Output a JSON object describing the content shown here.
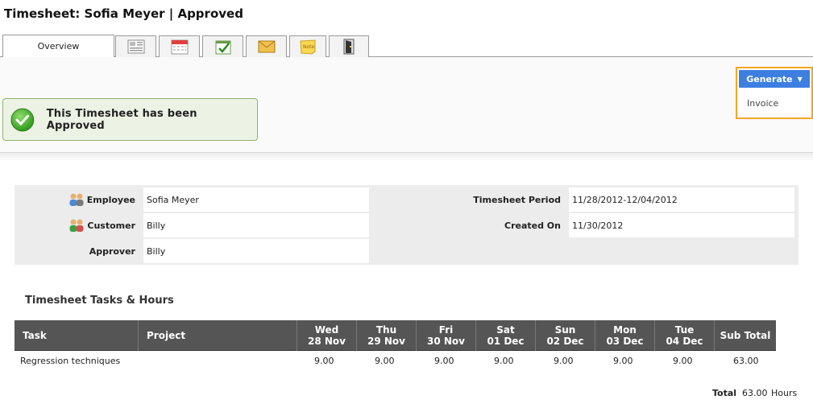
{
  "header": {
    "title": "Timesheet: Sofia Meyer | Approved"
  },
  "tabs": [
    {
      "label": "Overview",
      "icon": "overview"
    },
    {
      "label": "",
      "icon": "details-list-icon"
    },
    {
      "label": "",
      "icon": "calendar-icon"
    },
    {
      "label": "",
      "icon": "approval-check-icon"
    },
    {
      "label": "",
      "icon": "mail-icon"
    },
    {
      "label": "",
      "icon": "note-icon"
    },
    {
      "label": "",
      "icon": "door-exit-icon"
    }
  ],
  "status": {
    "message": "This Timesheet has been Approved",
    "color": "#4caf3a"
  },
  "generate": {
    "button_label": "Generate",
    "menu_item": "Invoice",
    "accent": "#3d7fe0",
    "highlight": "#f5a623"
  },
  "info": {
    "employee_label": "Employee",
    "employee_value": "Sofia Meyer",
    "customer_label": "Customer",
    "customer_value": "Billy",
    "approver_label": "Approver",
    "approver_value": "Billy",
    "period_label": "Timesheet Period",
    "period_value": "11/28/2012-12/04/2012",
    "created_label": "Created On",
    "created_value": "11/30/2012"
  },
  "tasks": {
    "title": "Timesheet Tasks & Hours",
    "columns": {
      "task": "Task",
      "project": "Project",
      "days": [
        {
          "day": "Wed",
          "date": "28 Nov"
        },
        {
          "day": "Thu",
          "date": "29 Nov"
        },
        {
          "day": "Fri",
          "date": "30 Nov"
        },
        {
          "day": "Sat",
          "date": "01 Dec"
        },
        {
          "day": "Sun",
          "date": "02 Dec"
        },
        {
          "day": "Mon",
          "date": "03 Dec"
        },
        {
          "day": "Tue",
          "date": "04 Dec"
        }
      ],
      "subtotal": "Sub Total"
    },
    "rows": [
      {
        "task": "Regression techniques",
        "project": "",
        "hours": [
          "9.00",
          "9.00",
          "9.00",
          "9.00",
          "9.00",
          "9.00",
          "9.00"
        ],
        "subtotal": "63.00"
      }
    ],
    "total_label": "Total",
    "total_value": "63.00",
    "total_unit": "Hours"
  }
}
